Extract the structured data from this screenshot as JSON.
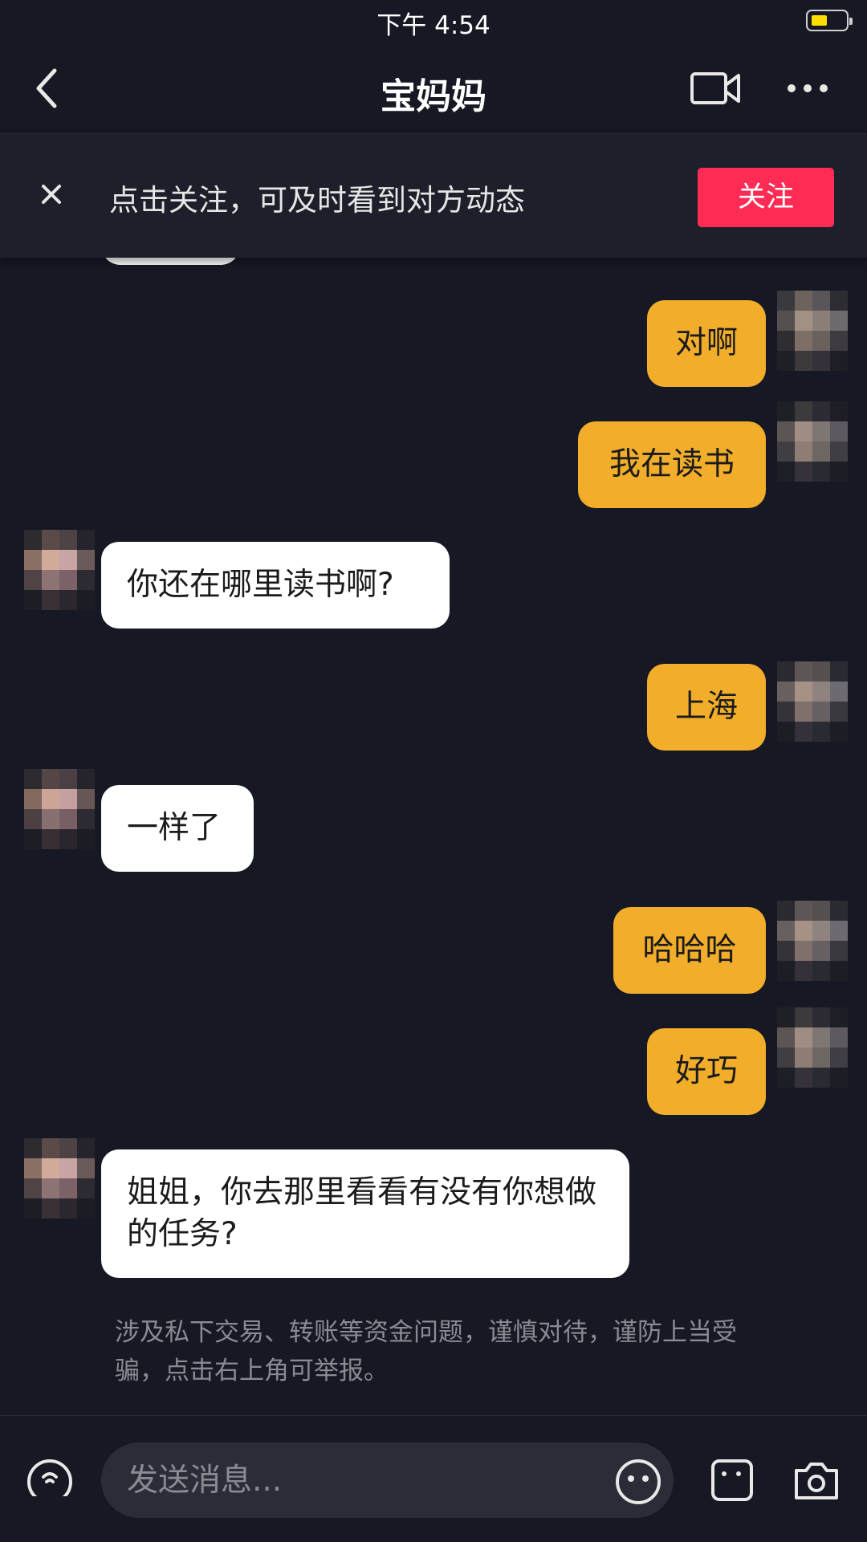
{
  "status_bar": {
    "time": "下午 4:54",
    "battery_icon": "battery-icon"
  },
  "header": {
    "title": "宝妈妈",
    "back_icon": "chevron-left-icon",
    "video_icon": "video-camera-icon",
    "more_icon": "more-horizontal-icon"
  },
  "follow_banner": {
    "text": "点击关注，可及时看到对方动态",
    "button_label": "关注",
    "close_icon": "close-icon"
  },
  "messages": [
    {
      "sender": "me",
      "text": "对啊"
    },
    {
      "sender": "me",
      "text": "我在读书"
    },
    {
      "sender": "them",
      "text": "你还在哪里读书啊?"
    },
    {
      "sender": "me",
      "text": "上海"
    },
    {
      "sender": "them",
      "text": "一样了"
    },
    {
      "sender": "me",
      "text": "哈哈哈"
    },
    {
      "sender": "me",
      "text": "好巧"
    },
    {
      "sender": "them",
      "text": "姐姐，你去那里看看有没有你想做的任务?"
    }
  ],
  "safety_notice": "涉及私下交易、转账等资金问题，谨慎对待，谨防上当受骗，点击右上角可举报。",
  "input_bar": {
    "placeholder": "发送消息...",
    "voice_icon": "voice-icon",
    "emoji_icon": "emoji-icon",
    "image_icon": "image-icon",
    "camera_icon": "camera-icon"
  },
  "colors": {
    "background": "#161823",
    "my_bubble": "#f2ae2b",
    "their_bubble": "#ffffff",
    "follow_button": "#fe2c55"
  }
}
